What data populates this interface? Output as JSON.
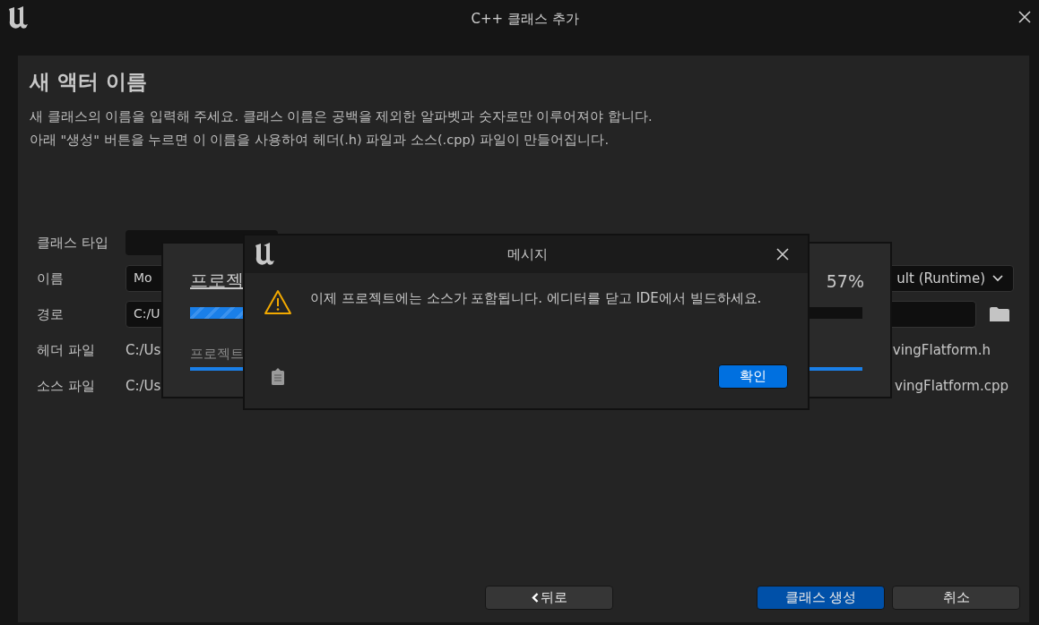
{
  "window": {
    "title": "C++ 클래스 추가"
  },
  "heading": "새 액터 이름",
  "description": [
    "새 클래스의 이름을 입력해 주세요. 클래스 이름은 공백을 제외한 알파벳과 숫자로만 이루어져야 합니다.",
    "아래 \"생성\" 버튼을 누르면 이 이름을 사용하여 헤더(.h) 파일과 소스(.cpp) 파일이 만들어집니다."
  ],
  "form": {
    "class_type": {
      "label": "클래스 타입"
    },
    "name": {
      "label": "이름",
      "value": "Mo",
      "module": "ult (Runtime)"
    },
    "path": {
      "label": "경로",
      "value": "C:/U"
    },
    "header_file": {
      "label": "헤더 파일",
      "path_start": "C:/Us",
      "path_end": "vingFlatform.h"
    },
    "source_file": {
      "label": "소스 파일",
      "path_start": "C:/Us",
      "path_end": "vingFlatform.cpp"
    }
  },
  "buttons": [
    {
      "label": "뒤로",
      "kind": "back"
    },
    {
      "label": "클래스 생성",
      "kind": "primary"
    },
    {
      "label": "취소",
      "kind": "normal"
    }
  ],
  "progress_dialog": {
    "title": "프로젝",
    "percent": "57%",
    "level": 0.57,
    "status": "프로젝트",
    "status_bar": {
      "level": 1
    }
  },
  "message_dialog": {
    "title": "메시지",
    "message": "이제 프로젝트에는 소스가 포함됩니다. 에디터를 닫고 IDE에서 빌드하세요.",
    "button": "확인"
  }
}
